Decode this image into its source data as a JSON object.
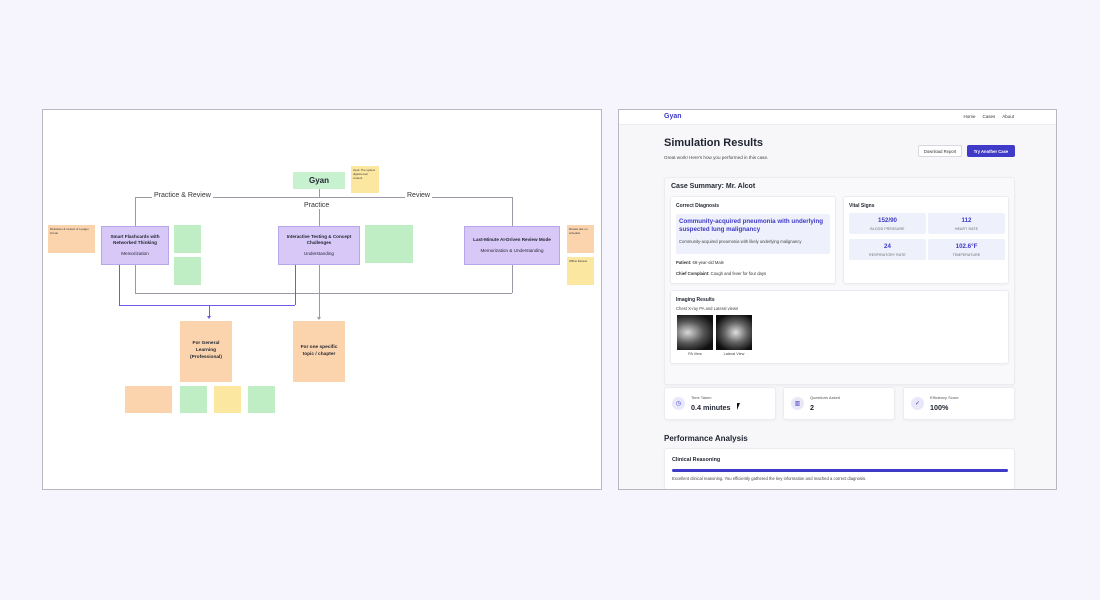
{
  "board": {
    "root": "Gyan",
    "practice_review": "Practice & Review",
    "review": "Review",
    "practice": "Practice",
    "cards": [
      {
        "title": "Smart Flashcards with Networked Thinking",
        "sub": "Memorization"
      },
      {
        "title": "Interactive Testing & Concept Challenges",
        "sub": "Understanding"
      },
      {
        "title": "Last-Minute AI-Driven Review Mode",
        "sub": "Memorization & Understanding"
      }
    ],
    "targets": [
      {
        "title": "For General Learning (Professional)"
      },
      {
        "title": "For one specific topic / chapter"
      }
    ],
    "sticky_top": "Input: The system digests user content",
    "sticky_left": "Motivation & context of 1-pager format",
    "sticky_right_1": "Review due on schedule",
    "sticky_right_2": "Offline Review"
  },
  "app": {
    "brand": "Gyan",
    "nav": [
      "Home",
      "Cases",
      "About"
    ],
    "title": "Simulation Results",
    "subtitle": "Great work! Here's how you performed in this case.",
    "download_label": "Download Report",
    "try_label": "Try Another Case",
    "summary_title": "Case Summary: Mr. Alcot",
    "diagnosis": {
      "heading": "Correct Diagnosis",
      "main": "Community-acquired pneumonia with underlying suspected lung malignancy",
      "alt": "Community-acquired pneumonia with likely underlying malignancy",
      "patient_label": "Patient:",
      "patient_value": "68-year-old Male",
      "complaint_label": "Chief Complaint:",
      "complaint_value": "Cough and fever for four days"
    },
    "vitals": {
      "heading": "Vital Signs",
      "items": [
        {
          "value": "152/90",
          "label": "BLOOD PRESSURE"
        },
        {
          "value": "112",
          "label": "HEART RATE"
        },
        {
          "value": "24",
          "label": "RESPIRATORY RATE"
        },
        {
          "value": "102.6°F",
          "label": "TEMPERATURE"
        }
      ]
    },
    "imaging": {
      "heading": "Imaging Results",
      "sub": "Chest X-ray PA and Lateral views",
      "captions": [
        "PA View",
        "Lateral View"
      ]
    },
    "stats": [
      {
        "icon": "clock-icon",
        "label": "Time Taken",
        "value": "0.4 minutes"
      },
      {
        "icon": "chart-icon",
        "label": "Questions Asked",
        "value": "2"
      },
      {
        "icon": "check-icon",
        "label": "Efficiency Score",
        "value": "100%"
      }
    ],
    "performance": {
      "heading": "Performance Analysis",
      "category": "Clinical Reasoning",
      "progress_percent": 100,
      "note": "Excellent clinical reasoning. You efficiently gathered the key information and reached a correct diagnosis."
    },
    "colors": {
      "accent": "#3f3ac7",
      "tint": "#eef0fb"
    }
  }
}
